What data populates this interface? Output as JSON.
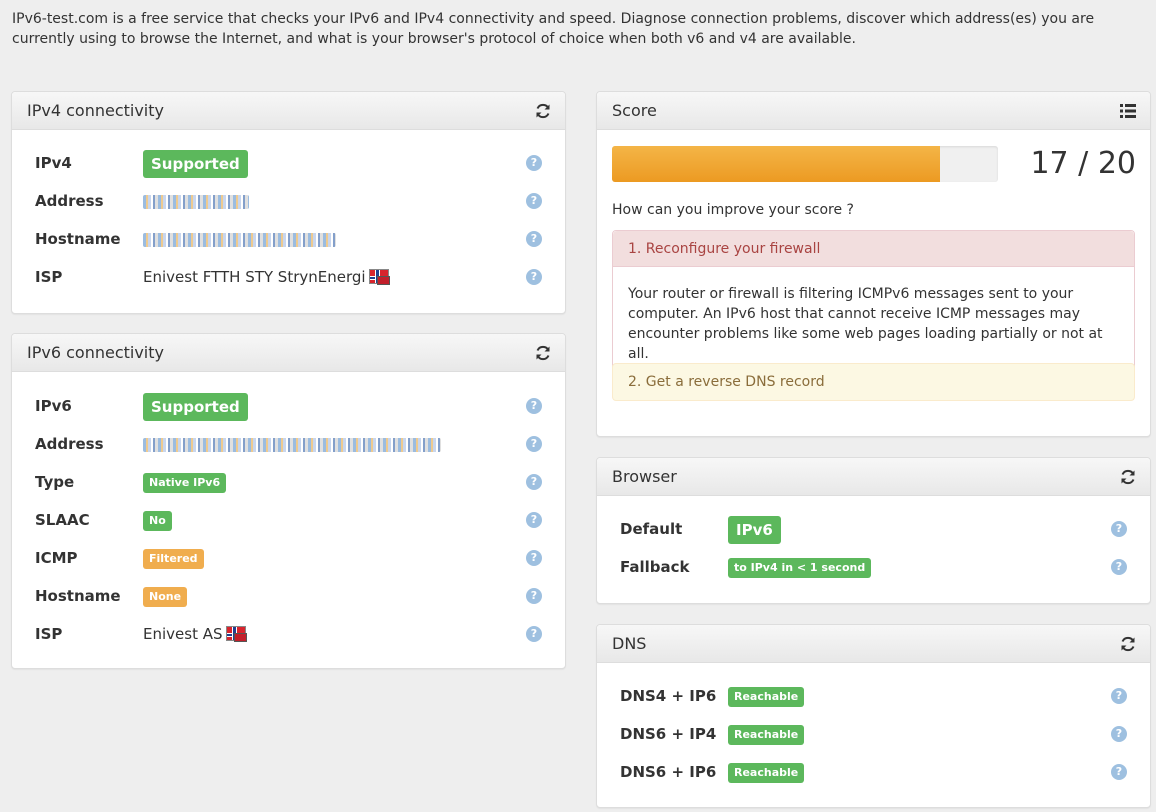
{
  "intro": "IPv6-test.com is a free service that checks your IPv6 and IPv4 connectivity and speed. Diagnose connection problems, discover which address(es) you are currently using to browse the Internet, and what is your browser's protocol of choice when both v6 and v4 are available.",
  "ipv4": {
    "title": "IPv4 connectivity",
    "rows": [
      {
        "label": "IPv4",
        "badge": "Supported"
      },
      {
        "label": "Address"
      },
      {
        "label": "Hostname"
      },
      {
        "label": "ISP",
        "value": "Enivest FTTH STY StrynEnergi"
      }
    ]
  },
  "ipv6": {
    "title": "IPv6 connectivity",
    "rows": [
      {
        "label": "IPv6",
        "badge": "Supported"
      },
      {
        "label": "Address"
      },
      {
        "label": "Type",
        "badge": "Native IPv6"
      },
      {
        "label": "SLAAC",
        "badge": "No"
      },
      {
        "label": "ICMP",
        "badge": "Filtered"
      },
      {
        "label": "Hostname",
        "badge": "None"
      },
      {
        "label": "ISP",
        "value": "Enivest AS"
      }
    ]
  },
  "score": {
    "title": "Score",
    "value": 17,
    "max": 20,
    "text": "17 / 20",
    "improve_prompt": "How can you improve your score ?",
    "tip1_title": "1. Reconfigure your firewall",
    "tip1_body": "Your router or firewall is filtering ICMPv6 messages sent to your computer. An IPv6 host that cannot receive ICMP messages may encounter problems like some web pages loading partially or not at all.",
    "tip2_title": "2. Get a reverse DNS record"
  },
  "browser": {
    "title": "Browser",
    "rows": [
      {
        "label": "Default",
        "badge": "IPv6"
      },
      {
        "label": "Fallback",
        "badge": "to IPv4 in < 1 second"
      }
    ]
  },
  "dns": {
    "title": "DNS",
    "rows": [
      {
        "label": "DNS4 + IP6",
        "badge": "Reachable"
      },
      {
        "label": "DNS6 + IP4",
        "badge": "Reachable"
      },
      {
        "label": "DNS6 + IP6",
        "badge": "Reachable"
      }
    ]
  },
  "help_glyph": "?",
  "icons": {
    "refresh": "refresh-icon",
    "list": "list-icon",
    "help": "help-icon",
    "flag": "norway-flag-icon"
  },
  "colors": {
    "success": "#5cb85c",
    "warning": "#f0ad4e",
    "danger_bg": "#f2dede",
    "warn_bg": "#fcf8e3"
  }
}
